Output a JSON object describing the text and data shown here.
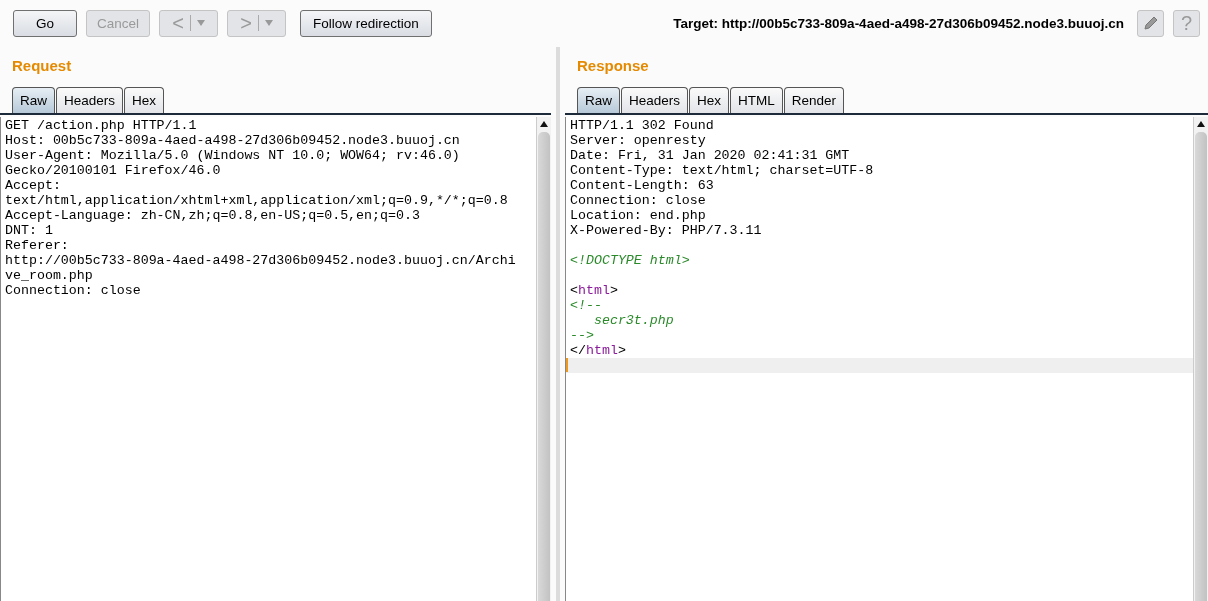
{
  "toolbar": {
    "buttons": [
      {
        "kind": "text",
        "label": "Go",
        "disabled": false
      },
      {
        "kind": "text",
        "label": "Cancel",
        "disabled": true
      },
      {
        "kind": "history",
        "label": "<",
        "disabled": true
      },
      {
        "kind": "history",
        "label": ">",
        "disabled": true
      },
      {
        "kind": "text",
        "label": "Follow redirection",
        "disabled": false
      }
    ],
    "target": "Target: http://00b5c733-809a-4aed-a498-27d306b09452.node3.buuoj.cn",
    "help_label": "?"
  },
  "request": {
    "title": "Request",
    "tabs": [
      {
        "label": "Raw",
        "selected": true
      },
      {
        "label": "Headers",
        "selected": false
      },
      {
        "label": "Hex",
        "selected": false
      }
    ],
    "lines": [
      {
        "segments": [
          {
            "kind": "plain",
            "text": "GET /action.php HTTP/1.1"
          }
        ]
      },
      {
        "segments": [
          {
            "kind": "plain",
            "text": "Host: 00b5c733-809a-4aed-a498-27d306b09452.node3.buuoj.cn"
          }
        ]
      },
      {
        "segments": [
          {
            "kind": "plain",
            "text": "User-Agent: Mozilla/5.0 (Windows NT 10.0; WOW64; rv:46.0)"
          }
        ]
      },
      {
        "segments": [
          {
            "kind": "plain",
            "text": "Gecko/20100101 Firefox/46.0"
          }
        ]
      },
      {
        "segments": [
          {
            "kind": "plain",
            "text": "Accept:"
          }
        ]
      },
      {
        "segments": [
          {
            "kind": "plain",
            "text": "text/html,application/xhtml+xml,application/xml;q=0.9,*/*;q=0.8"
          }
        ]
      },
      {
        "segments": [
          {
            "kind": "plain",
            "text": "Accept-Language: zh-CN,zh;q=0.8,en-US;q=0.5,en;q=0.3"
          }
        ]
      },
      {
        "segments": [
          {
            "kind": "plain",
            "text": "DNT: 1"
          }
        ]
      },
      {
        "segments": [
          {
            "kind": "plain",
            "text": "Referer:"
          }
        ]
      },
      {
        "segments": [
          {
            "kind": "plain",
            "text": "http://00b5c733-809a-4aed-a498-27d306b09452.node3.buuoj.cn/Archi"
          }
        ]
      },
      {
        "segments": [
          {
            "kind": "plain",
            "text": "ve_room.php"
          }
        ]
      },
      {
        "segments": [
          {
            "kind": "plain",
            "text": "Connection: close"
          }
        ]
      }
    ]
  },
  "response": {
    "title": "Response",
    "tabs": [
      {
        "label": "Raw",
        "selected": true
      },
      {
        "label": "Headers",
        "selected": false
      },
      {
        "label": "Hex",
        "selected": false
      },
      {
        "label": "HTML",
        "selected": false
      },
      {
        "label": "Render",
        "selected": false
      }
    ],
    "lines": [
      {
        "segments": [
          {
            "kind": "plain",
            "text": "HTTP/1.1 302 Found"
          }
        ]
      },
      {
        "segments": [
          {
            "kind": "plain",
            "text": "Server: openresty"
          }
        ]
      },
      {
        "segments": [
          {
            "kind": "plain",
            "text": "Date: Fri, 31 Jan 2020 02:41:31 GMT"
          }
        ]
      },
      {
        "segments": [
          {
            "kind": "plain",
            "text": "Content-Type: text/html; charset=UTF-8"
          }
        ]
      },
      {
        "segments": [
          {
            "kind": "plain",
            "text": "Content-Length: 63"
          }
        ]
      },
      {
        "segments": [
          {
            "kind": "plain",
            "text": "Connection: close"
          }
        ]
      },
      {
        "segments": [
          {
            "kind": "plain",
            "text": "Location: end.php"
          }
        ]
      },
      {
        "segments": [
          {
            "kind": "plain",
            "text": "X-Powered-By: PHP/7.3.11"
          }
        ]
      },
      {
        "blank_before": true,
        "segments": [
          {
            "kind": "comment",
            "text": "<!DOCTYPE html>"
          }
        ]
      },
      {
        "blank_before": true,
        "segments": [
          {
            "kind": "plain",
            "text": "<"
          },
          {
            "kind": "tag",
            "text": "html"
          },
          {
            "kind": "plain",
            "text": ">"
          }
        ]
      },
      {
        "segments": [
          {
            "kind": "comment",
            "text": "<!--"
          }
        ]
      },
      {
        "segments": [
          {
            "kind": "comment",
            "text": "   secr3t.php"
          }
        ]
      },
      {
        "segments": [
          {
            "kind": "comment",
            "text": "-->"
          }
        ]
      },
      {
        "segments": [
          {
            "kind": "plain",
            "text": "</"
          },
          {
            "kind": "tag",
            "text": "html"
          },
          {
            "kind": "plain",
            "text": ">"
          }
        ]
      }
    ],
    "cursor_line": true
  }
}
